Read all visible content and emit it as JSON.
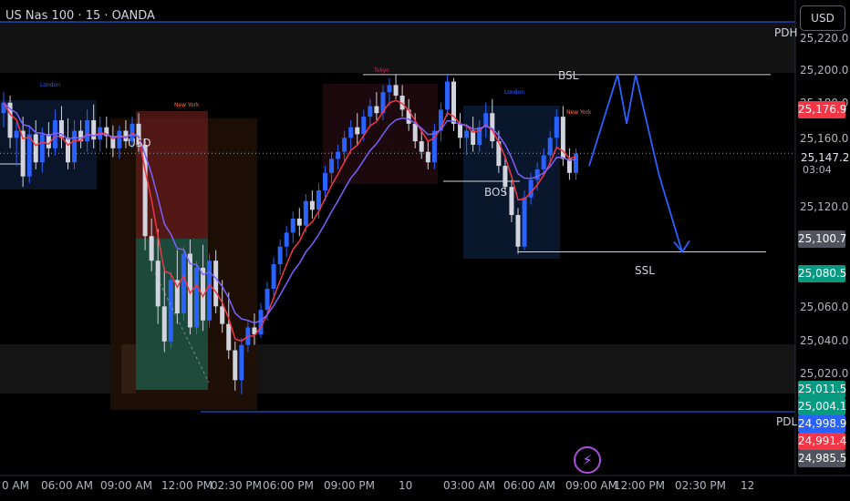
{
  "header": {
    "title": "US Nas 100 · 15 · OANDA",
    "currency_button": "USD"
  },
  "price_axis": {
    "ticks": [
      "25,220.0",
      "25,200.0",
      "25,180.0",
      "25,160.0",
      "25,147.2",
      "25,120.0",
      "25,100.0",
      "25,080.0",
      "25,060.0",
      "25,040.0",
      "25,020.0"
    ],
    "tick_values": [
      25220,
      25200,
      25180,
      25160,
      25147.2,
      25120,
      25100,
      25080,
      25060,
      25040,
      25020
    ],
    "current_price": "25,147.2",
    "countdown": "03:04"
  },
  "price_tags": [
    {
      "text": "25,176.9",
      "value": 25176.9,
      "color": "#f23645"
    },
    {
      "text": "25,100.7",
      "value": 25100.7,
      "color": "#50535e"
    },
    {
      "text": "25,080.5",
      "value": 25080.5,
      "color": "#089981"
    },
    {
      "text": "25,011.5",
      "value": 25011.5,
      "color": "#089981"
    },
    {
      "text": "25,004.1",
      "value": 25004.1,
      "color": "#089981"
    },
    {
      "text": "24,998.9",
      "value": 24998.9,
      "color": "#2962ff"
    },
    {
      "text": "24,991.4",
      "value": 24991.4,
      "color": "#f23645"
    },
    {
      "text": "24,985.5",
      "value": 24985.5,
      "color": "#50535e"
    }
  ],
  "time_axis": [
    "0 AM",
    "06:00 AM",
    "09:00 AM",
    "12:00 PM",
    "02:30 PM",
    "06:00 PM",
    "09:00 PM",
    "10",
    "03:00 AM",
    "06:00 AM",
    "09:00 AM",
    "12:00 PM",
    "02:30 PM",
    "12"
  ],
  "annotations": {
    "pdh": "PDH",
    "pdl": "PDL",
    "bsl": "BSL",
    "ssl": "SSL",
    "bos": "BOS",
    "usd": "USD",
    "sessions": [
      {
        "text": "London",
        "color": "#2962ff"
      },
      {
        "text": "New York",
        "color": "#ff6d3a"
      },
      {
        "text": "Tokyo",
        "color": "#e91e63"
      },
      {
        "text": "London",
        "color": "#2962ff"
      },
      {
        "text": "New York",
        "color": "#ff6d3a"
      }
    ]
  },
  "chart_data": {
    "type": "candlestick",
    "title": "US Nas 100 · 15 · OANDA",
    "ylim": [
      24985,
      25230
    ],
    "levels": {
      "PDH": 25222,
      "BSL": 25192,
      "SSL": 25091,
      "PDL": 25000
    },
    "colors": {
      "up": "#2962ff",
      "down": "#d1d4dc",
      "ema_fast": "#f23645",
      "ema_slow": "#7b61ff",
      "projection": "#2962ff"
    },
    "candles": [
      [
        25170,
        25182,
        25162,
        25176
      ],
      [
        25176,
        25180,
        25150,
        25156
      ],
      [
        25156,
        25165,
        25140,
        25160
      ],
      [
        25160,
        25168,
        25128,
        25134
      ],
      [
        25134,
        25162,
        25130,
        25158
      ],
      [
        25158,
        25166,
        25138,
        25142
      ],
      [
        25142,
        25162,
        25136,
        25158
      ],
      [
        25158,
        25165,
        25145,
        25150
      ],
      [
        25150,
        25172,
        25146,
        25166
      ],
      [
        25166,
        25174,
        25150,
        25156
      ],
      [
        25156,
        25167,
        25138,
        25142
      ],
      [
        25142,
        25166,
        25138,
        25160
      ],
      [
        25160,
        25166,
        25150,
        25154
      ],
      [
        25154,
        25172,
        25148,
        25166
      ],
      [
        25166,
        25175,
        25150,
        25155
      ],
      [
        25155,
        25168,
        25148,
        25162
      ],
      [
        25162,
        25168,
        25150,
        25157
      ],
      [
        25157,
        25163,
        25145,
        25150
      ],
      [
        25150,
        25163,
        25144,
        25160
      ],
      [
        25160,
        25166,
        25150,
        25154
      ],
      [
        25154,
        25168,
        25150,
        25164
      ],
      [
        25164,
        25170,
        25148,
        25152
      ],
      [
        25152,
        25155,
        25092,
        25100
      ],
      [
        25100,
        25110,
        25080,
        25086
      ],
      [
        25086,
        25104,
        25050,
        25060
      ],
      [
        25060,
        25082,
        25034,
        25040
      ],
      [
        25040,
        25080,
        25036,
        25075
      ],
      [
        25075,
        25092,
        25050,
        25056
      ],
      [
        25056,
        25094,
        25052,
        25090
      ],
      [
        25090,
        25098,
        25044,
        25048
      ],
      [
        25048,
        25086,
        25044,
        25082
      ],
      [
        25082,
        25095,
        25046,
        25052
      ],
      [
        25052,
        25090,
        25048,
        25086
      ],
      [
        25086,
        25092,
        25056,
        25060
      ],
      [
        25060,
        25075,
        25045,
        25050
      ],
      [
        25050,
        25068,
        25030,
        25035
      ],
      [
        25035,
        25040,
        25012,
        25018
      ],
      [
        25018,
        25042,
        25010,
        25038
      ],
      [
        25038,
        25052,
        25034,
        25048
      ],
      [
        25048,
        25056,
        25038,
        25044
      ],
      [
        25044,
        25062,
        25042,
        25058
      ],
      [
        25058,
        25074,
        25052,
        25070
      ],
      [
        25070,
        25088,
        25064,
        25084
      ],
      [
        25084,
        25098,
        25078,
        25094
      ],
      [
        25094,
        25106,
        25088,
        25102
      ],
      [
        25102,
        25114,
        25096,
        25110
      ],
      [
        25110,
        25116,
        25100,
        25106
      ],
      [
        25106,
        25124,
        25102,
        25120
      ],
      [
        25120,
        25126,
        25110,
        25115
      ],
      [
        25115,
        25130,
        25110,
        25126
      ],
      [
        25126,
        25140,
        25120,
        25136
      ],
      [
        25136,
        25148,
        25130,
        25144
      ],
      [
        25144,
        25152,
        25138,
        25148
      ],
      [
        25148,
        25160,
        25142,
        25156
      ],
      [
        25156,
        25166,
        25148,
        25162
      ],
      [
        25162,
        25170,
        25152,
        25158
      ],
      [
        25158,
        25172,
        25154,
        25168
      ],
      [
        25168,
        25178,
        25162,
        25174
      ],
      [
        25174,
        25182,
        25166,
        25170
      ],
      [
        25170,
        25186,
        25166,
        25182
      ],
      [
        25182,
        25190,
        25174,
        25186
      ],
      [
        25186,
        25192,
        25178,
        25180
      ],
      [
        25180,
        25186,
        25168,
        25172
      ],
      [
        25172,
        25178,
        25160,
        25164
      ],
      [
        25164,
        25170,
        25150,
        25154
      ],
      [
        25154,
        25160,
        25144,
        25148
      ],
      [
        25148,
        25154,
        25138,
        25142
      ],
      [
        25142,
        25164,
        25138,
        25160
      ],
      [
        25160,
        25176,
        25154,
        25172
      ],
      [
        25172,
        25192,
        25168,
        25188
      ],
      [
        25188,
        25190,
        25160,
        25164
      ],
      [
        25164,
        25170,
        25150,
        25156
      ],
      [
        25156,
        25164,
        25146,
        25160
      ],
      [
        25160,
        25168,
        25148,
        25152
      ],
      [
        25152,
        25166,
        25148,
        25162
      ],
      [
        25162,
        25176,
        25156,
        25170
      ],
      [
        25170,
        25178,
        25150,
        25154
      ],
      [
        25154,
        25160,
        25136,
        25140
      ],
      [
        25140,
        25146,
        25124,
        25128
      ],
      [
        25128,
        25132,
        25108,
        25112
      ],
      [
        25112,
        25116,
        25090,
        25094
      ],
      [
        25094,
        25126,
        25092,
        25122
      ],
      [
        25122,
        25136,
        25118,
        25132
      ],
      [
        25132,
        25142,
        25126,
        25138
      ],
      [
        25138,
        25150,
        25134,
        25146
      ],
      [
        25146,
        25160,
        25140,
        25156
      ],
      [
        25156,
        25172,
        25150,
        25168
      ],
      [
        25168,
        25174,
        25140,
        25144
      ],
      [
        25144,
        25150,
        25132,
        25136
      ],
      [
        25136,
        25150,
        25132,
        25147
      ]
    ],
    "projection": [
      [
        25140,
        25174
      ],
      [
        25192,
        25196
      ],
      [
        25164,
        25203
      ],
      [
        25192,
        25210
      ],
      [
        25135,
        25228
      ],
      [
        25091,
        25246
      ]
    ]
  }
}
